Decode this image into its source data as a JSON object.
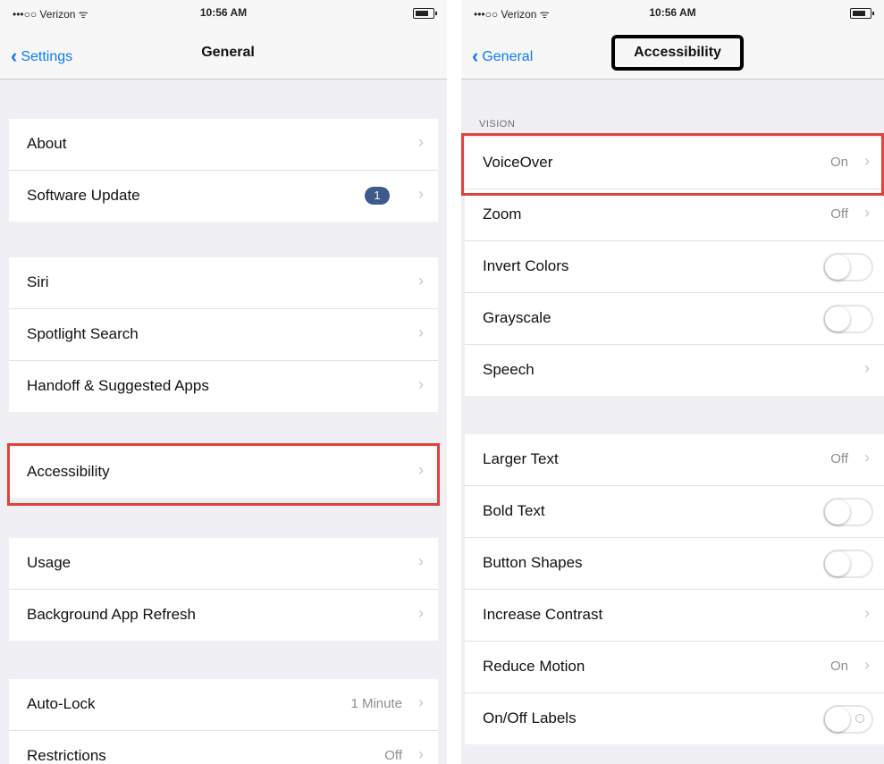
{
  "left": {
    "status": {
      "carrier": "•••○○ Verizon ᯤ",
      "time": "10:56 AM"
    },
    "nav": {
      "back_label": "Settings",
      "title": "General"
    },
    "groups": [
      {
        "rows": [
          {
            "label": "About"
          },
          {
            "label": "Software Update",
            "badge": "1"
          }
        ]
      },
      {
        "rows": [
          {
            "label": "Siri"
          },
          {
            "label": "Spotlight Search"
          },
          {
            "label": "Handoff & Suggested Apps"
          }
        ]
      },
      {
        "rows": [
          {
            "label": "Accessibility"
          }
        ]
      },
      {
        "rows": [
          {
            "label": "Usage"
          },
          {
            "label": "Background App Refresh"
          }
        ]
      },
      {
        "rows": [
          {
            "label": "Auto-Lock",
            "value": "1 Minute"
          },
          {
            "label": "Restrictions",
            "value": "Off"
          }
        ]
      }
    ]
  },
  "right": {
    "status": {
      "carrier": "•••○○ Verizon ᯤ",
      "time": "10:56 AM"
    },
    "nav": {
      "back_label": "General",
      "title": "Accessibility"
    },
    "section_header": "VISION",
    "groups": [
      {
        "rows": [
          {
            "label": "VoiceOver",
            "value": "On"
          },
          {
            "label": "Zoom",
            "value": "Off"
          },
          {
            "label": "Invert Colors",
            "toggle": false
          },
          {
            "label": "Grayscale",
            "toggle": false
          },
          {
            "label": "Speech"
          }
        ]
      },
      {
        "rows": [
          {
            "label": "Larger Text",
            "value": "Off"
          },
          {
            "label": "Bold Text",
            "toggle": false
          },
          {
            "label": "Button Shapes",
            "toggle": false
          },
          {
            "label": "Increase Contrast"
          },
          {
            "label": "Reduce Motion",
            "value": "On"
          },
          {
            "label": "On/Off Labels",
            "toggle": false
          }
        ]
      }
    ]
  },
  "colors": {
    "highlight": "#e0423c",
    "link": "#0a7aff",
    "title_box": "#000000"
  }
}
